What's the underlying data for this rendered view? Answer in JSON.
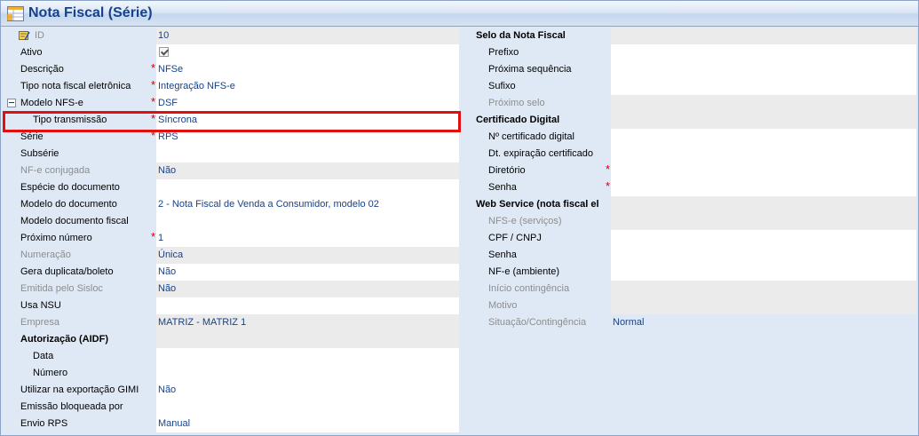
{
  "window": {
    "title": "Nota Fiscal (Série)",
    "icon": "table-form-icon"
  },
  "left": {
    "id": {
      "label": "ID",
      "value": "10"
    },
    "ativo": {
      "label": "Ativo",
      "checked": true
    },
    "descricao": {
      "label": "Descrição",
      "value": "NFSe"
    },
    "tipo_nf_eletronica": {
      "label": "Tipo nota fiscal eletrônica",
      "value": "Integração NFS-e"
    },
    "modelo_nfse": {
      "label": "Modelo NFS-e",
      "value": "DSF"
    },
    "tipo_transmissao": {
      "label": "Tipo transmissão",
      "value": "Síncrona"
    },
    "serie": {
      "label": "Série",
      "value": "RPS"
    },
    "subserie": {
      "label": "Subsérie",
      "value": ""
    },
    "nfe_conjugada": {
      "label": "NF-e conjugada",
      "value": "Não"
    },
    "especie_documento": {
      "label": "Espécie do documento",
      "value": ""
    },
    "modelo_documento": {
      "label": "Modelo do documento",
      "value": "2 - Nota Fiscal de Venda a Consumidor, modelo 02"
    },
    "modelo_documento_fiscal": {
      "label": "Modelo documento fiscal",
      "value": ""
    },
    "proximo_numero": {
      "label": "Próximo número",
      "value": "1"
    },
    "numeracao": {
      "label": "Numeração",
      "value": "Única"
    },
    "gera_duplicata": {
      "label": "Gera duplicata/boleto",
      "value": "Não"
    },
    "emitida_sisloc": {
      "label": "Emitida pelo Sisloc",
      "value": "Não"
    },
    "usa_nsu": {
      "label": "Usa NSU",
      "value": ""
    },
    "empresa": {
      "label": "Empresa",
      "value": "MATRIZ - MATRIZ 1"
    },
    "autorizacao": {
      "label": "Autorização (AIDF)"
    },
    "data": {
      "label": "Data",
      "value": ""
    },
    "numero": {
      "label": "Número",
      "value": ""
    },
    "exportacao_gimi": {
      "label": "Utilizar na exportação GIMI",
      "value": "Não"
    },
    "emissao_bloqueada": {
      "label": "Emissão bloqueada por",
      "value": ""
    },
    "envio_rps": {
      "label": "Envio RPS",
      "value": "Manual"
    }
  },
  "right": {
    "selo_header": {
      "label": "Selo da Nota Fiscal"
    },
    "prefixo": {
      "label": "Prefixo",
      "value": ""
    },
    "proxima_sequencia": {
      "label": "Próxima sequência",
      "value": ""
    },
    "sufixo": {
      "label": "Sufixo",
      "value": ""
    },
    "proximo_selo": {
      "label": "Próximo selo",
      "value": ""
    },
    "certificado_header": {
      "label": "Certificado Digital"
    },
    "num_certificado": {
      "label": "Nº certificado digital",
      "value": ""
    },
    "dt_expiracao": {
      "label": "Dt. expiração certificado",
      "value": ""
    },
    "diretorio": {
      "label": "Diretório",
      "value": ""
    },
    "senha_cert": {
      "label": "Senha",
      "value": ""
    },
    "webservice_header": {
      "label": "Web Service (nota fiscal el"
    },
    "nfse_servicos": {
      "label": "NFS-e (serviços)",
      "value": ""
    },
    "cpf_cnpj": {
      "label": "CPF / CNPJ",
      "value": ""
    },
    "senha_ws": {
      "label": "Senha",
      "value": ""
    },
    "nfe_ambiente": {
      "label": "NF-e (ambiente)",
      "value": ""
    },
    "inicio_contingencia": {
      "label": "Início contingência",
      "value": ""
    },
    "motivo": {
      "label": "Motivo",
      "value": ""
    },
    "situacao_contingencia": {
      "label": "Situação/Contingência",
      "value": "Normal"
    }
  },
  "required_mark": "*",
  "colors": {
    "title": "#15428b",
    "highlight": "#e01010",
    "required": "#cc0000",
    "label_bg": "#dfe9f5",
    "disabled": "#8d8d8d"
  }
}
